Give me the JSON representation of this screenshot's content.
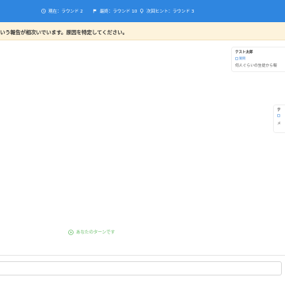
{
  "status_bar": {
    "current_round": "現在：ラウンド 2",
    "latest_round": "最終：ラウンド 10",
    "next_hint": "次回ヒント：ラウンド 3"
  },
  "banner": {
    "text": "いう報告が相次いでいます。原因を特定してください。"
  },
  "messages": [
    {
      "sender": "テスト太郎",
      "tag": "質問",
      "text": "何人ぐらいの生徒から報"
    },
    {
      "sender": "テ",
      "tag": "",
      "text": "メ"
    }
  ],
  "turn_indicator": {
    "text": "あなたのターンです"
  },
  "composer": {
    "value": "",
    "placeholder": ""
  },
  "colors": {
    "status_bar_bg": "#2f86e0",
    "banner_bg": "#fdf3dc",
    "turn_green": "#6bbf6b",
    "tag_blue": "#3d86d8"
  },
  "icons": {
    "current_round": "clock-icon",
    "latest_round": "flag-icon",
    "next_hint": "lightbulb-icon",
    "tag": "tag-icon",
    "turn": "play-circle-icon"
  }
}
